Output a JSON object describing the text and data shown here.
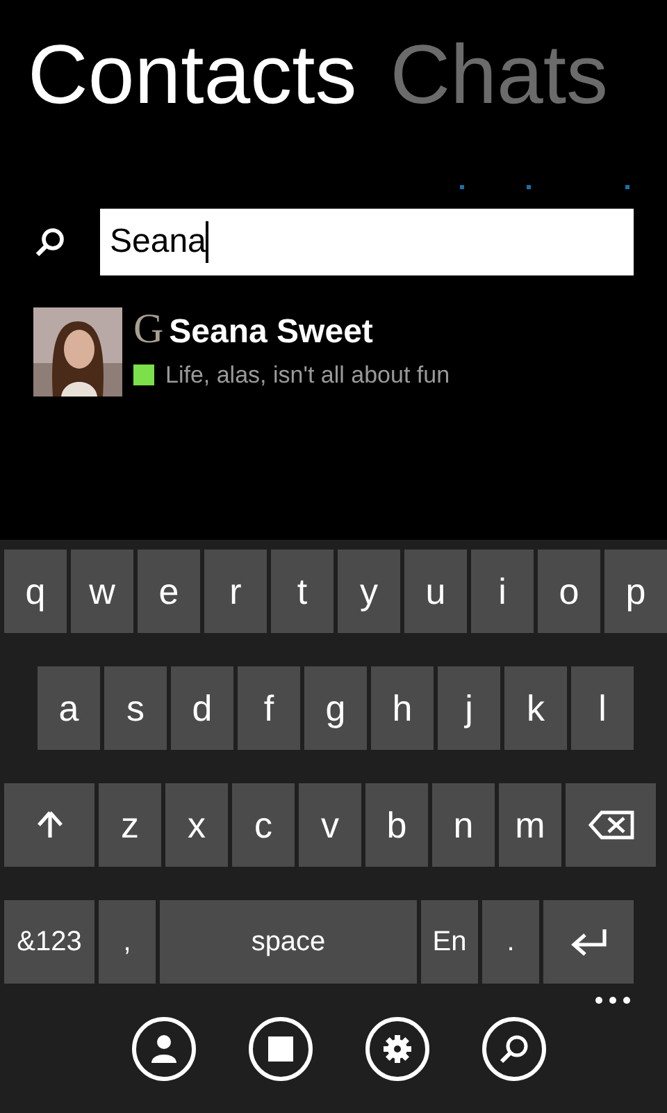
{
  "pivot": [
    {
      "label": "Contacts",
      "selected": true
    },
    {
      "label": "Chats",
      "selected": false
    }
  ],
  "search": {
    "value": "Seana"
  },
  "results": [
    {
      "name": "Seana Sweet",
      "network": "G",
      "status": "Life, alas, isn't all about fun",
      "color": "#7be04a"
    }
  ],
  "keyboard": [
    [
      {
        "kind": "char",
        "label": "q"
      },
      {
        "kind": "char",
        "label": "w"
      },
      {
        "kind": "char",
        "label": "e"
      },
      {
        "kind": "char",
        "label": "r"
      },
      {
        "kind": "char",
        "label": "t"
      },
      {
        "kind": "char",
        "label": "y"
      },
      {
        "kind": "char",
        "label": "u"
      },
      {
        "kind": "char",
        "label": "i"
      },
      {
        "kind": "char",
        "label": "o"
      },
      {
        "kind": "char",
        "label": "p"
      }
    ],
    [
      {
        "kind": "char",
        "label": "a"
      },
      {
        "kind": "char",
        "label": "s"
      },
      {
        "kind": "char",
        "label": "d"
      },
      {
        "kind": "char",
        "label": "f"
      },
      {
        "kind": "char",
        "label": "g"
      },
      {
        "kind": "char",
        "label": "h"
      },
      {
        "kind": "char",
        "label": "j"
      },
      {
        "kind": "char",
        "label": "k"
      },
      {
        "kind": "char",
        "label": "l"
      }
    ],
    [
      {
        "kind": "shift"
      },
      {
        "kind": "char",
        "label": "z"
      },
      {
        "kind": "char",
        "label": "x"
      },
      {
        "kind": "char",
        "label": "c"
      },
      {
        "kind": "char",
        "label": "v"
      },
      {
        "kind": "char",
        "label": "b"
      },
      {
        "kind": "char",
        "label": "n"
      },
      {
        "kind": "char",
        "label": "m"
      },
      {
        "kind": "backspace"
      }
    ],
    [
      {
        "kind": "wide",
        "label": "&123"
      },
      {
        "kind": "char",
        "label": ","
      },
      {
        "kind": "space",
        "label": "space"
      },
      {
        "kind": "char",
        "label": "En"
      },
      {
        "kind": "char",
        "label": "."
      },
      {
        "kind": "enter"
      }
    ]
  ],
  "app_bar": [
    {
      "kind": "person"
    },
    {
      "kind": "stop"
    },
    {
      "kind": "settings"
    },
    {
      "kind": "search"
    }
  ]
}
